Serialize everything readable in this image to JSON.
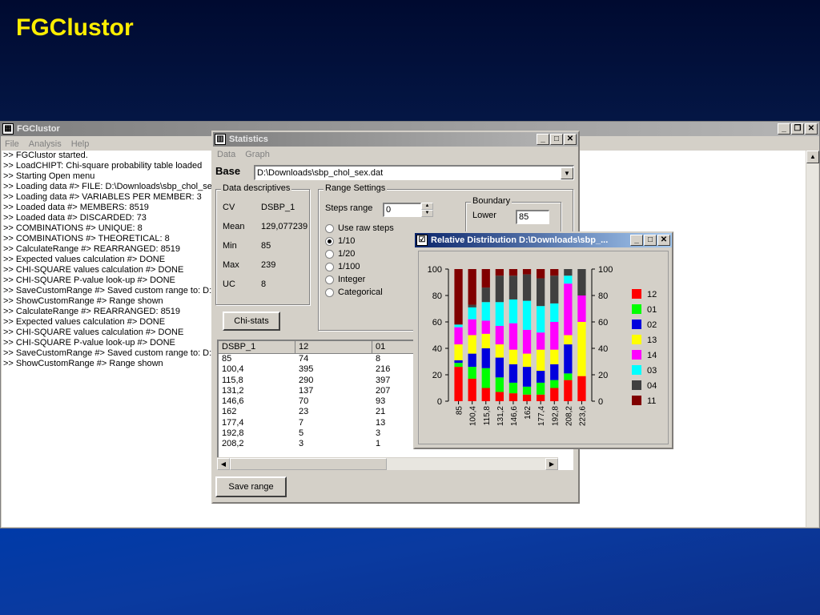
{
  "slide_title": "FGClustor",
  "main_window": {
    "title": "FGClustor",
    "menu": [
      "File",
      "Analysis",
      "Help"
    ],
    "log_lines": [
      ">> FGClustor started.",
      ">> LoadCHIPT: Chi-square probability table loaded",
      ">> Starting Open menu",
      ">> Loading data #> FILE: D:\\Downloads\\sbp_chol_sex.dat",
      ">> Loading data #> VARIABLES PER MEMBER: 3",
      ">> Loaded data #> MEMBERS: 8519",
      ">> Loaded data #> DISCARDED: 73",
      ">> COMBINATIONS #> UNIQUE: 8",
      ">> COMBINATIONS #> THEORETICAL: 8",
      ">> CalculateRange #> REARRANGED: 8519",
      ">> Expected values calculation #> DONE",
      ">> CHI-SQUARE values calculation #> DONE",
      ">> CHI-SQUARE P-value look-up #> DONE",
      ">> SaveCustomRange #> Saved custom range to: D:\\Downloads",
      ">> ShowCustomRange #> Range shown",
      ">> CalculateRange #> REARRANGED: 8519",
      ">> Expected values calculation #> DONE",
      ">> CHI-SQUARE values calculation #> DONE",
      ">> CHI-SQUARE P-value look-up #> DONE",
      ">> SaveCustomRange #> Saved custom range to: D:\\Downloads",
      ">> ShowCustomRange #> Range shown"
    ]
  },
  "stats_window": {
    "title": "Statistics",
    "menu": [
      "Data",
      "Graph"
    ],
    "base_label": "Base",
    "base_path": "D:\\Downloads\\sbp_chol_sex.dat",
    "descriptives": {
      "group_label": "Data descriptives",
      "rows": [
        {
          "label": "CV",
          "value": "DSBP_1"
        },
        {
          "label": "Mean",
          "value": "129,077239"
        },
        {
          "label": "Min",
          "value": "85"
        },
        {
          "label": "Max",
          "value": "239"
        },
        {
          "label": "UC",
          "value": "8"
        }
      ]
    },
    "range": {
      "group_label": "Range Settings",
      "steps_label": "Steps range",
      "steps_value": "0",
      "options": [
        "Use raw steps",
        "1/10",
        "1/20",
        "1/100",
        "Integer",
        "Categorical"
      ],
      "selected_index": 1,
      "boundary_label": "Boundary",
      "lower_label": "Lower",
      "lower_value": "85"
    },
    "chi_button": "Chi-stats",
    "save_button": "Save range",
    "table": {
      "headers": [
        "DSBP_1",
        "12",
        "01"
      ],
      "rows": [
        [
          "85",
          "74",
          "8"
        ],
        [
          "100,4",
          "395",
          "216"
        ],
        [
          "115,8",
          "290",
          "397"
        ],
        [
          "131,2",
          "137",
          "207"
        ],
        [
          "146,6",
          "70",
          "93"
        ],
        [
          "162",
          "23",
          "21"
        ],
        [
          "177,4",
          "7",
          "13"
        ],
        [
          "192,8",
          "5",
          "3"
        ],
        [
          "208,2",
          "3",
          "1"
        ]
      ]
    }
  },
  "chart_window": {
    "title": "Relative Distribution D:\\Downloads\\sbp_...",
    "chart_data": {
      "type": "bar",
      "stacked": true,
      "categories": [
        "85",
        "100,4",
        "115,8",
        "131,2",
        "146,6",
        "162",
        "177,4",
        "192,8",
        "208,2",
        "223,6"
      ],
      "ylim": [
        0,
        100
      ],
      "yticks": [
        "0",
        "20",
        "40",
        "60",
        "80",
        "100"
      ],
      "series": [
        {
          "name": "12",
          "color": "#ff0000",
          "values": [
            26,
            17,
            10,
            7,
            6,
            5,
            5,
            10,
            16,
            19
          ]
        },
        {
          "name": "01",
          "color": "#00ff00",
          "values": [
            3,
            9,
            15,
            11,
            8,
            6,
            9,
            6,
            5,
            0
          ]
        },
        {
          "name": "02",
          "color": "#0000dd",
          "values": [
            2,
            10,
            15,
            15,
            14,
            15,
            9,
            12,
            22,
            0
          ]
        },
        {
          "name": "13",
          "color": "#ffff00",
          "values": [
            12,
            14,
            11,
            10,
            11,
            10,
            16,
            11,
            7,
            41
          ]
        },
        {
          "name": "14",
          "color": "#ff00ff",
          "values": [
            13,
            12,
            10,
            14,
            20,
            18,
            13,
            21,
            39,
            20
          ]
        },
        {
          "name": "03",
          "color": "#00ffff",
          "values": [
            2,
            9,
            14,
            18,
            18,
            22,
            20,
            14,
            6,
            0
          ]
        },
        {
          "name": "04",
          "color": "#404040",
          "values": [
            0,
            2,
            11,
            20,
            18,
            20,
            21,
            21,
            5,
            20
          ]
        },
        {
          "name": "11",
          "color": "#800000",
          "values": [
            42,
            27,
            14,
            5,
            5,
            4,
            7,
            5,
            0,
            0
          ]
        }
      ],
      "legend_position": "right"
    }
  }
}
